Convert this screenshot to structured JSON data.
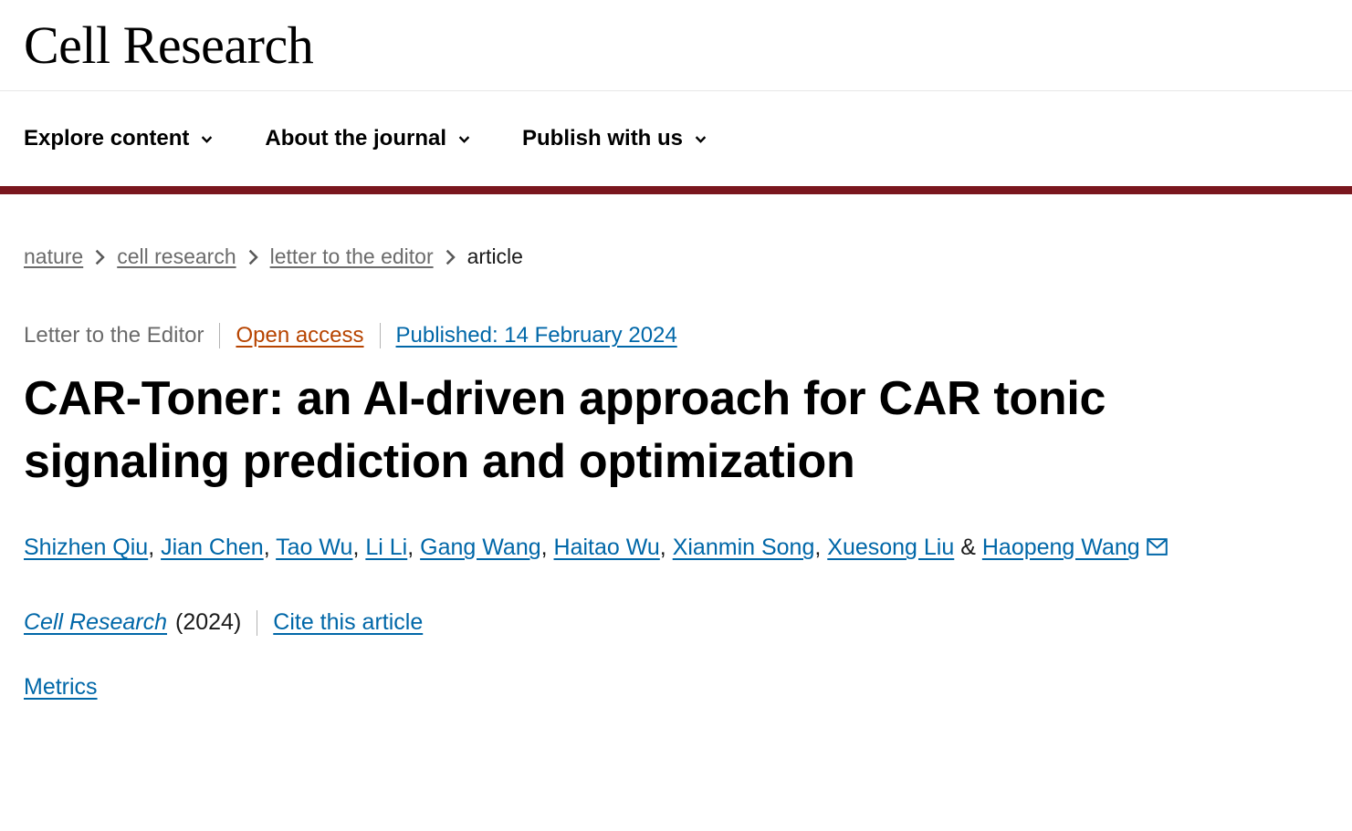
{
  "header": {
    "journal_title": "Cell Research",
    "accent_color": "#7a171e",
    "nav_items": [
      {
        "label": "Explore content",
        "icon": "chevron-down-icon"
      },
      {
        "label": "About the journal",
        "icon": "chevron-down-icon"
      },
      {
        "label": "Publish with us",
        "icon": "chevron-down-icon"
      }
    ]
  },
  "breadcrumb": {
    "items": [
      {
        "label": "nature",
        "is_link": true
      },
      {
        "label": "cell research",
        "is_link": true
      },
      {
        "label": "letter to the editor",
        "is_link": true
      },
      {
        "label": "article",
        "is_link": false
      }
    ],
    "separator_icon": "chevron-right-icon"
  },
  "article": {
    "type": "Letter to the Editor",
    "access": "Open access",
    "access_color": "#b74400",
    "published": "Published: 14 February 2024",
    "link_color": "#0067a8",
    "title": "CAR-Toner: an AI-driven approach for CAR tonic signaling prediction and optimization",
    "authors": [
      "Shizhen Qiu",
      "Jian Chen",
      "Tao Wu",
      "Li Li",
      "Gang Wang",
      "Haitao Wu",
      "Xianmin Song",
      "Xuesong Liu",
      "Haopeng Wang"
    ],
    "author_separator": ", ",
    "final_author_conjunction": " & ",
    "corresponding_author_icon": "envelope-icon",
    "journal_name": "Cell Research",
    "journal_year": "(2024)",
    "cite_label": "Cite this article",
    "metrics_label": "Metrics"
  }
}
